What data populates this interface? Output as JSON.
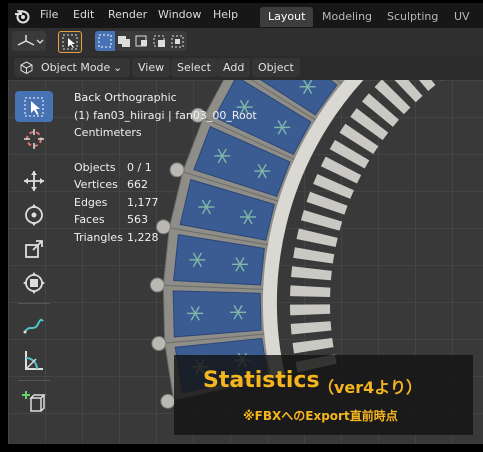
{
  "menus": [
    "File",
    "Edit",
    "Render",
    "Window",
    "Help"
  ],
  "workspace_tabs": [
    {
      "label": "Layout",
      "active": true
    },
    {
      "label": "Modeling",
      "active": false
    },
    {
      "label": "Sculpting",
      "active": false
    },
    {
      "label": "UV E",
      "active": false
    }
  ],
  "viewport_header": {
    "mode": "Object Mode",
    "menus": [
      "View",
      "Select",
      "Add",
      "Object"
    ]
  },
  "overlay": {
    "view_name": "Back Orthographic",
    "object_path": "(1) fan03_hiiragi | fan03_00_Root",
    "units": "Centimeters",
    "stats": [
      {
        "label": "Objects",
        "value": "0 / 1"
      },
      {
        "label": "Vertices",
        "value": "662"
      },
      {
        "label": "Edges",
        "value": "1,177"
      },
      {
        "label": "Faces",
        "value": "563"
      },
      {
        "label": "Triangles",
        "value": "1,228"
      }
    ]
  },
  "tools": [
    "select-box",
    "cursor",
    "move",
    "rotate",
    "scale",
    "transform",
    "annotate",
    "measure",
    "add-cube"
  ],
  "caption": {
    "title": "Statistics",
    "subtitle": "（ver4より）",
    "note": "※FBXへのExport直前時点"
  },
  "colors": {
    "accent_blue": "#4772b3",
    "caption_orange": "#f5b51f",
    "panel_blue": "#3b5c93"
  }
}
